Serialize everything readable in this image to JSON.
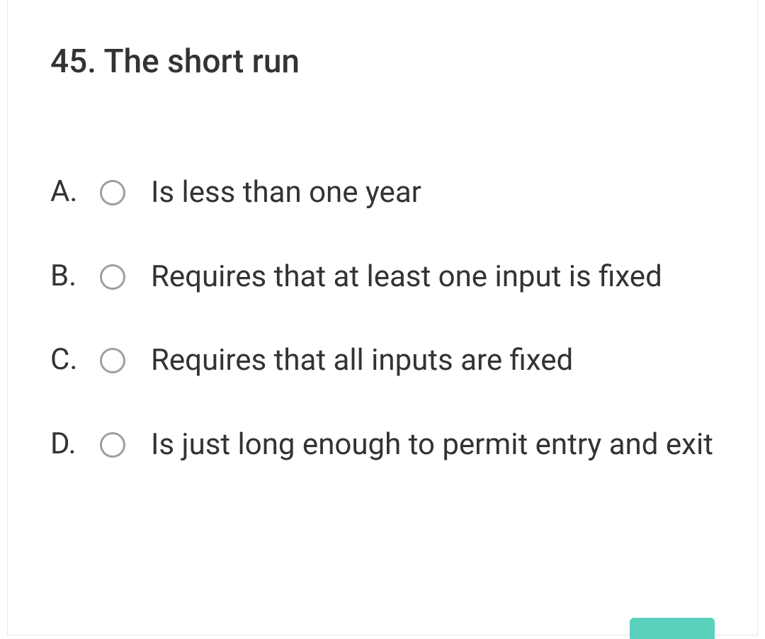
{
  "question": {
    "number": "45.",
    "text": "The short run"
  },
  "options": [
    {
      "letter": "A.",
      "text": "Is less than one year"
    },
    {
      "letter": "B.",
      "text": "Requires that at least one input is fixed"
    },
    {
      "letter": "C.",
      "text": "Requires that all inputs are fixed"
    },
    {
      "letter": "D.",
      "text": "Is just long enough to permit entry and exit"
    }
  ]
}
